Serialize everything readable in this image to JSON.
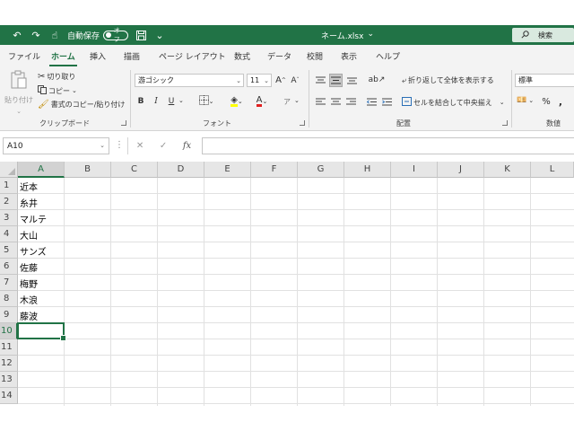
{
  "titlebar": {
    "autosave_label": "自動保存",
    "autosave_state": "オフ",
    "filename": "ネーム.xlsx",
    "search_label": "検索",
    "bg_color": "#217346"
  },
  "menu": {
    "tabs": [
      "ファイル",
      "ホーム",
      "挿入",
      "描画",
      "ページ レイアウト",
      "数式",
      "データ",
      "校閲",
      "表示",
      "ヘルプ"
    ],
    "active": "ホーム"
  },
  "ribbon": {
    "clipboard": {
      "paste": "貼り付け",
      "cut": "切り取り",
      "copy": "コピー",
      "format_painter": "書式のコピー/貼り付け",
      "label": "クリップボード"
    },
    "font": {
      "font_name": "游ゴシック",
      "font_size": "11",
      "bold": "B",
      "italic": "I",
      "underline": "U",
      "label": "フォント"
    },
    "alignment": {
      "wrap_text": "折り返して全体を表示する",
      "merge_center": "セルを結合して中央揃え",
      "label": "配置"
    },
    "number": {
      "format": "標準",
      "label": "数値"
    }
  },
  "formula_bar": {
    "name_box": "A10",
    "content": ""
  },
  "sheet": {
    "columns": [
      "A",
      "B",
      "C",
      "D",
      "E",
      "F",
      "G",
      "H",
      "I",
      "J",
      "K",
      "L"
    ],
    "rows": [
      "1",
      "2",
      "3",
      "4",
      "5",
      "6",
      "7",
      "8",
      "9",
      "10",
      "11",
      "12",
      "13",
      "14"
    ],
    "col_a_values": [
      "近本",
      "糸井",
      "マルテ",
      "大山",
      "サンズ",
      "佐藤",
      "梅野",
      "木浪",
      "藤波"
    ],
    "selected_col": "A",
    "selected_row": "10"
  }
}
